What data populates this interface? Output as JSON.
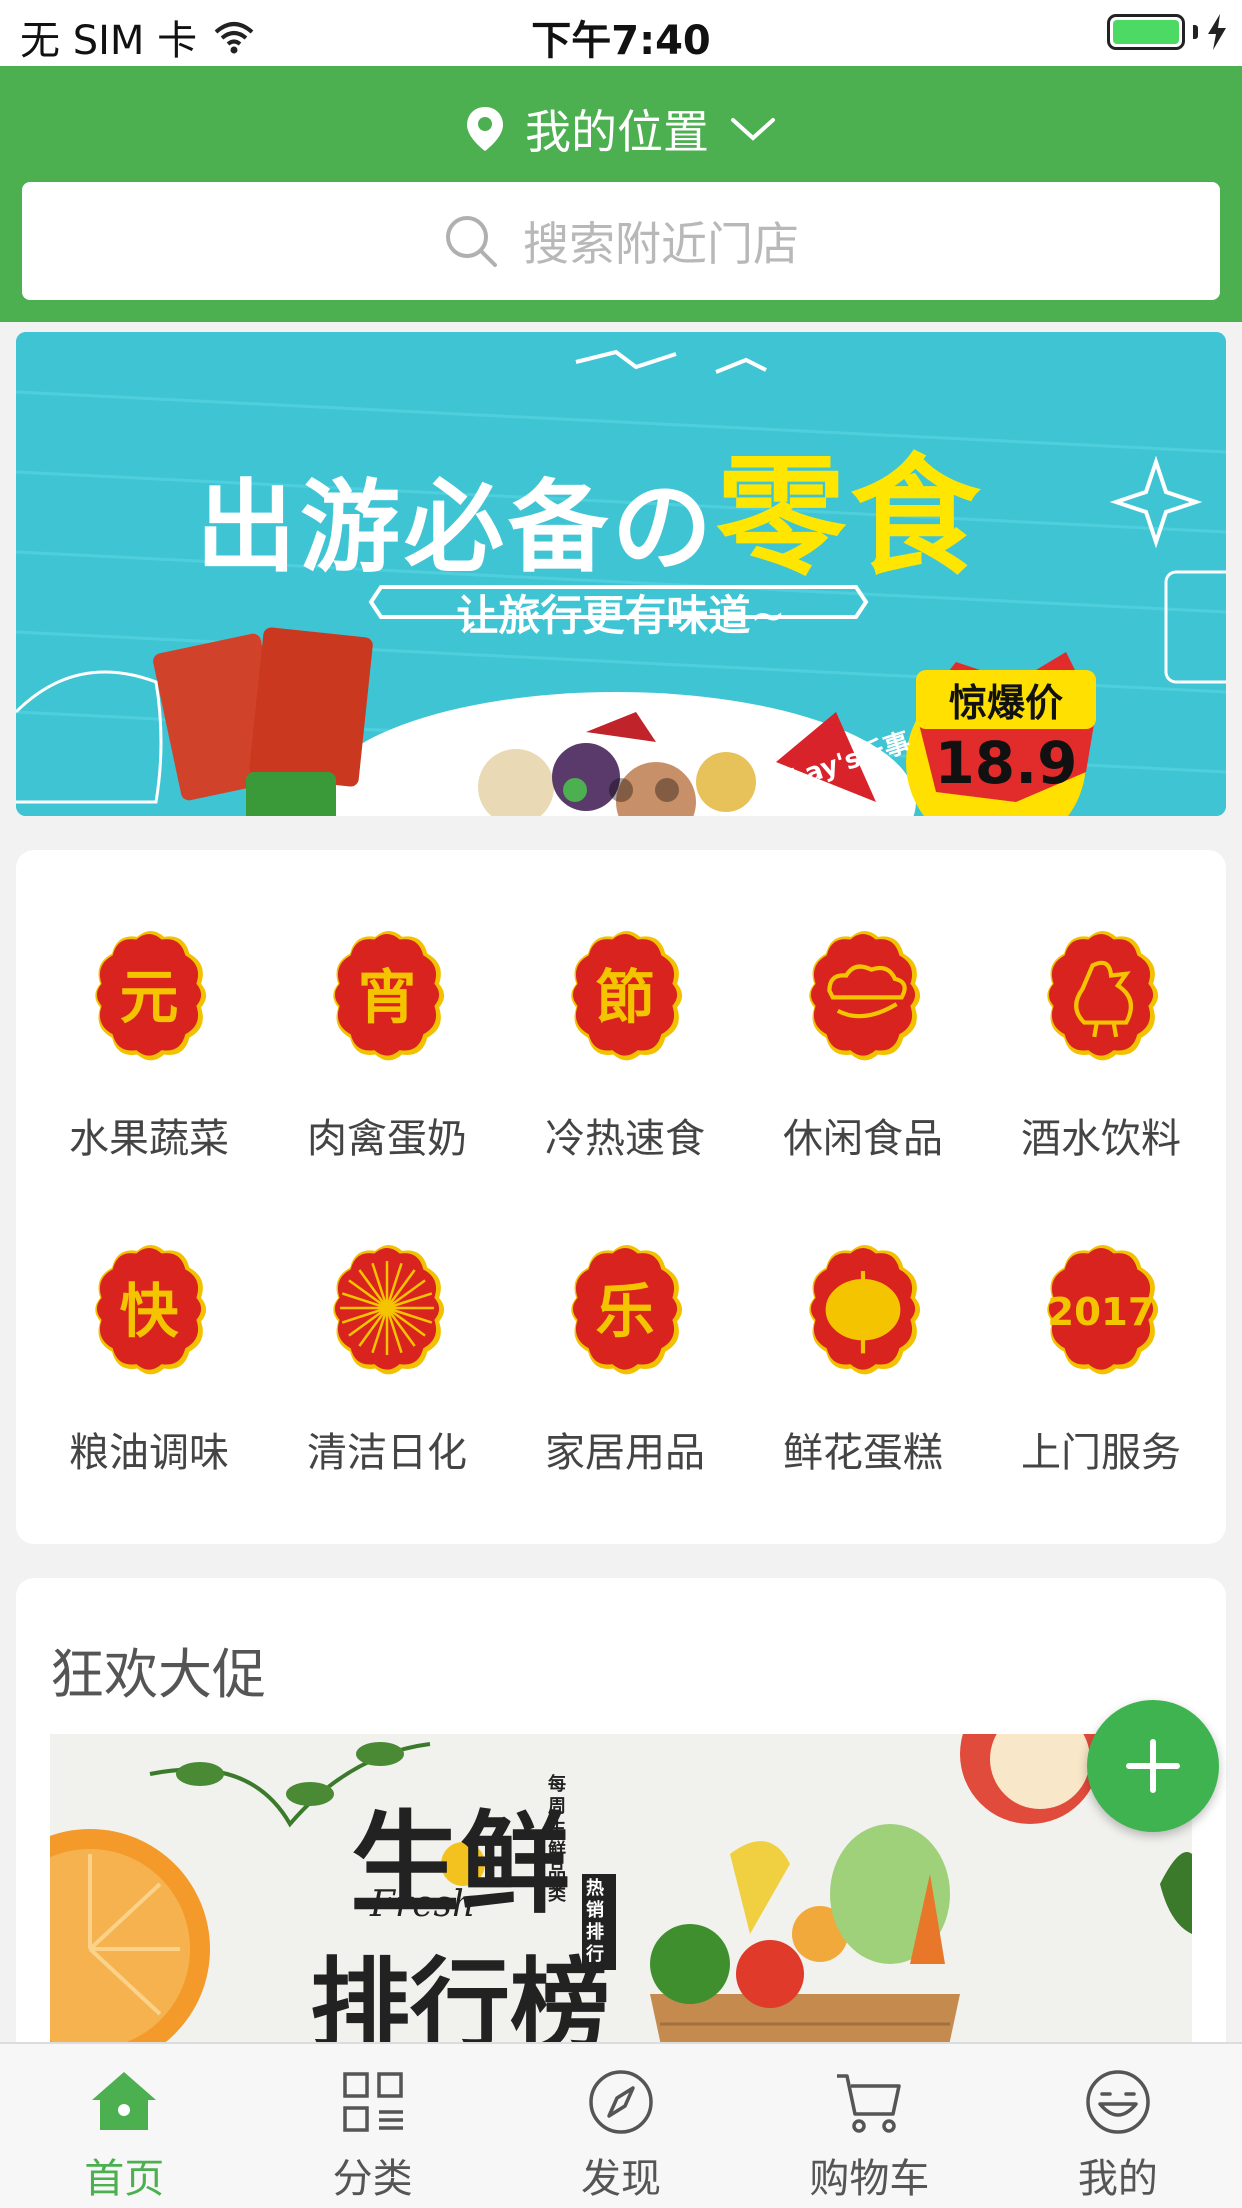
{
  "status_bar": {
    "carrier": "无 SIM 卡",
    "time": "下午7:40"
  },
  "header": {
    "location_label": "我的位置",
    "search_placeholder": "搜索附近门店",
    "theme_color": "#4caf50"
  },
  "banner": {
    "headline_left": "出游必备の",
    "headline_right": "零食",
    "subtitle": "让旅行更有味道~",
    "badge_label": "惊爆价",
    "badge_price": "18.9",
    "brand_text": "Lay's乐事",
    "dots": 3,
    "active_dot": 0
  },
  "categories": [
    {
      "label": "水果蔬菜",
      "glyph": "元",
      "icon": "yuan-badge-icon"
    },
    {
      "label": "肉禽蛋奶",
      "glyph": "宵",
      "icon": "xiao-badge-icon"
    },
    {
      "label": "冷热速食",
      "glyph": "節",
      "icon": "jie-badge-icon"
    },
    {
      "label": "休闲食品",
      "glyph": "",
      "icon": "cloud-badge-icon"
    },
    {
      "label": "酒水饮料",
      "glyph": "",
      "icon": "rooster-badge-icon"
    },
    {
      "label": "粮油调味",
      "glyph": "快",
      "icon": "kuai-badge-icon"
    },
    {
      "label": "清洁日化",
      "glyph": "",
      "icon": "fireworks-badge-icon"
    },
    {
      "label": "家居用品",
      "glyph": "乐",
      "icon": "le-badge-icon"
    },
    {
      "label": "鲜花蛋糕",
      "glyph": "",
      "icon": "lantern-badge-icon"
    },
    {
      "label": "上门服务",
      "glyph": "2017",
      "icon": "year-badge-icon"
    }
  ],
  "promo": {
    "title": "狂欢大促",
    "poster_main": "生鲜",
    "poster_sub": "排行榜",
    "poster_script": "Fresh",
    "poster_side1": "每周生鲜品类",
    "poster_side2": "热销排行"
  },
  "tabs": [
    {
      "label": "首页",
      "icon": "home-icon",
      "active": true
    },
    {
      "label": "分类",
      "icon": "grid-icon",
      "active": false
    },
    {
      "label": "发现",
      "icon": "compass-icon",
      "active": false
    },
    {
      "label": "购物车",
      "icon": "cart-icon",
      "active": false
    },
    {
      "label": "我的",
      "icon": "smiley-icon",
      "active": false
    }
  ]
}
